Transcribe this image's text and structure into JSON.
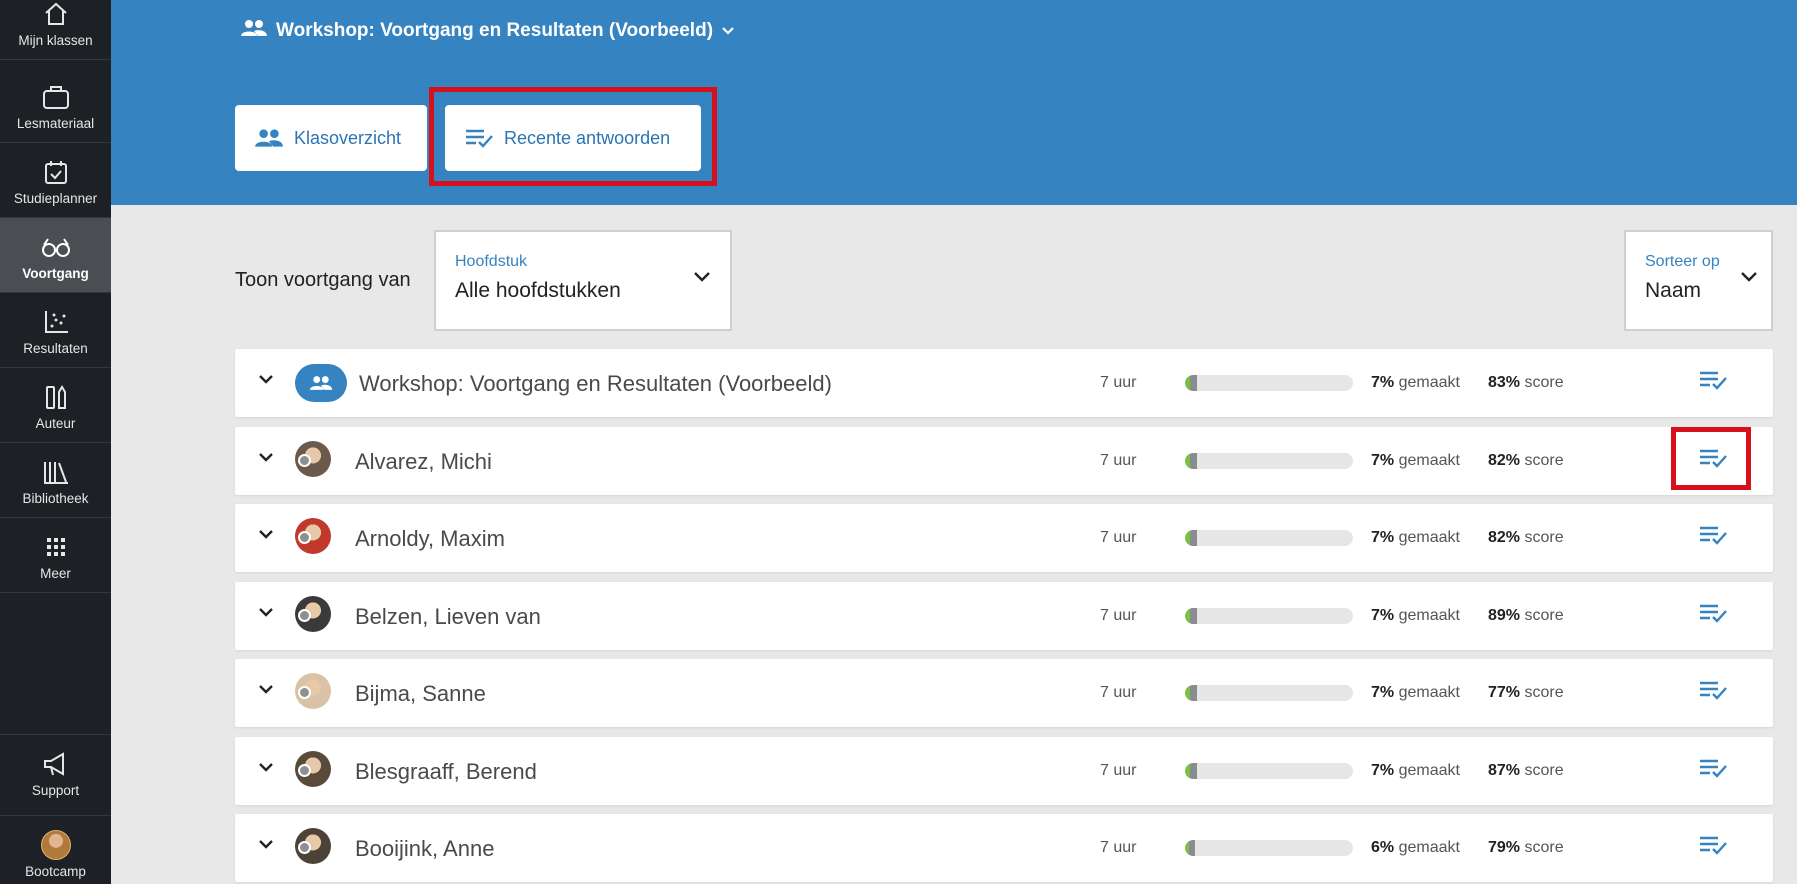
{
  "sidebar": {
    "items": [
      {
        "label": "Mijn klassen",
        "icon": "home-icon"
      },
      {
        "label": "Lesmateriaal",
        "icon": "briefcase-icon"
      },
      {
        "label": "Studieplanner",
        "icon": "calendar-check-icon"
      },
      {
        "label": "Voortgang",
        "icon": "glasses-icon",
        "active": true
      },
      {
        "label": "Resultaten",
        "icon": "scatter-chart-icon"
      },
      {
        "label": "Auteur",
        "icon": "author-tools-icon"
      },
      {
        "label": "Bibliotheek",
        "icon": "library-icon"
      },
      {
        "label": "Meer",
        "icon": "grid-icon"
      }
    ],
    "support_label": "Support",
    "user_label": "Bootcamp"
  },
  "header": {
    "class_title": "Workshop: Voortgang en Resultaten (Voorbeeld)",
    "tabs": [
      {
        "label": "Klasoverzicht",
        "icon": "people-icon"
      },
      {
        "label": "Recente antwoorden",
        "icon": "list-check-icon"
      }
    ]
  },
  "filters": {
    "show_label": "Toon voortgang van",
    "chapter": {
      "label": "Hoofdstuk",
      "value": "Alle hoofdstukken"
    },
    "sort": {
      "label": "Sorteer op",
      "value": "Naam"
    }
  },
  "rows": [
    {
      "name": "Workshop: Voortgang en Resultaten (Voorbeeld)",
      "hours": "7 uur",
      "made_pct": "7%",
      "made_label": "gemaakt",
      "score_pct": "83%",
      "score_label": "score",
      "progress": 0.07,
      "is_group": true
    },
    {
      "name": "Alvarez, Michi",
      "hours": "7 uur",
      "made_pct": "7%",
      "made_label": "gemaakt",
      "score_pct": "82%",
      "score_label": "score",
      "progress": 0.07,
      "avatar_color": "#6b5a4c"
    },
    {
      "name": "Arnoldy, Maxim",
      "hours": "7 uur",
      "made_pct": "7%",
      "made_label": "gemaakt",
      "score_pct": "82%",
      "score_label": "score",
      "progress": 0.07,
      "avatar_color": "#c0392b"
    },
    {
      "name": "Belzen, Lieven van",
      "hours": "7 uur",
      "made_pct": "7%",
      "made_label": "gemaakt",
      "score_pct": "89%",
      "score_label": "score",
      "progress": 0.07,
      "avatar_color": "#3a3a3a"
    },
    {
      "name": "Bijma, Sanne",
      "hours": "7 uur",
      "made_pct": "7%",
      "made_label": "gemaakt",
      "score_pct": "77%",
      "score_label": "score",
      "progress": 0.07,
      "avatar_color": "#d9c2a6"
    },
    {
      "name": "Blesgraaff, Berend",
      "hours": "7 uur",
      "made_pct": "7%",
      "made_label": "gemaakt",
      "score_pct": "87%",
      "score_label": "score",
      "progress": 0.07,
      "avatar_color": "#5a4a3a"
    },
    {
      "name": "Booijink, Anne",
      "hours": "7 uur",
      "made_pct": "6%",
      "made_label": "gemaakt",
      "score_pct": "79%",
      "score_label": "score",
      "progress": 0.06,
      "avatar_color": "#4d4238"
    }
  ],
  "colors": {
    "header_blue": "#3583c1",
    "highlight_red": "#d6111b",
    "sidebar_bg": "#1d2024"
  }
}
